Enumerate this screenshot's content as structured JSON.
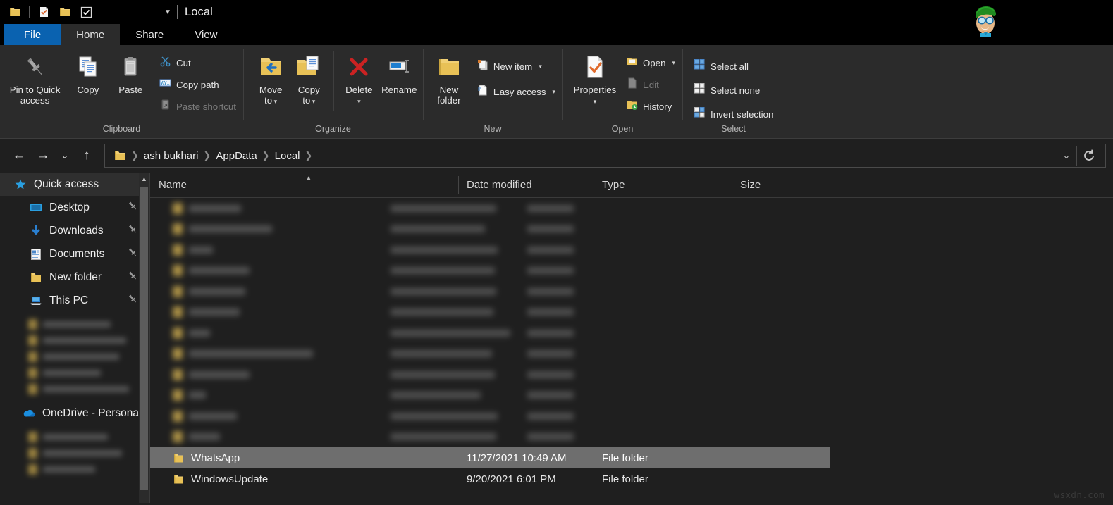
{
  "window": {
    "title": "Local",
    "quick_access_toolbar": [
      {
        "name": "properties-folder-icon",
        "label": "Properties"
      },
      {
        "name": "new-folder-icon",
        "label": "New folder"
      },
      {
        "name": "customize-checkbox-icon",
        "label": "Customize Quick Access Toolbar"
      }
    ],
    "caret_label": "Customize Quick Access Toolbar",
    "avatar_label": "user-avatar"
  },
  "tabs": [
    {
      "id": "file",
      "label": "File",
      "state": "file-menu"
    },
    {
      "id": "home",
      "label": "Home",
      "state": "active"
    },
    {
      "id": "share",
      "label": "Share",
      "state": "normal"
    },
    {
      "id": "view",
      "label": "View",
      "state": "normal"
    }
  ],
  "ribbon": {
    "groups": [
      {
        "title": "Clipboard",
        "big_buttons": [
          {
            "name": "pin-to-quick-access-button",
            "label": "Pin to Quick\naccess",
            "line1": "Pin to Quick",
            "line2": "access",
            "icon": "pin-icon"
          },
          {
            "name": "copy-button",
            "label": "Copy",
            "icon": "copy-documents-icon"
          },
          {
            "name": "paste-button",
            "label": "Paste",
            "icon": "clipboard-icon"
          }
        ],
        "small_buttons": [
          {
            "name": "cut-button",
            "label": "Cut",
            "icon": "scissors-icon",
            "disabled": false
          },
          {
            "name": "copy-path-button",
            "label": "Copy path",
            "icon": "copy-path-icon",
            "disabled": false
          },
          {
            "name": "paste-shortcut-button",
            "label": "Paste shortcut",
            "icon": "paste-shortcut-icon",
            "disabled": true
          }
        ]
      },
      {
        "title": "Organize",
        "big_buttons": [
          {
            "name": "move-to-button",
            "line1": "Move",
            "line2": "to",
            "label": "Move to",
            "icon": "move-to-icon",
            "dropdown": true
          },
          {
            "name": "copy-to-button",
            "line1": "Copy",
            "line2": "to",
            "label": "Copy to",
            "icon": "copy-to-icon",
            "dropdown": true
          },
          {
            "name": "delete-button",
            "label": "Delete",
            "icon": "red-x-icon",
            "dropdown": true
          },
          {
            "name": "rename-button",
            "label": "Rename",
            "icon": "rename-icon",
            "dropdown": false
          }
        ],
        "small_buttons": []
      },
      {
        "title": "New",
        "big_buttons": [
          {
            "name": "new-folder-button",
            "line1": "New",
            "line2": "folder",
            "label": "New folder",
            "icon": "new-folder-icon"
          }
        ],
        "small_buttons": [
          {
            "name": "new-item-button",
            "label": "New item",
            "icon": "new-item-icon",
            "dropdown": true
          },
          {
            "name": "easy-access-button",
            "label": "Easy access",
            "icon": "easy-access-icon",
            "dropdown": true
          }
        ]
      },
      {
        "title": "Open",
        "big_buttons": [
          {
            "name": "properties-button",
            "label": "Properties",
            "icon": "properties-icon",
            "dropdown": true
          }
        ],
        "small_buttons": [
          {
            "name": "open-button",
            "label": "Open",
            "icon": "open-folder-icon",
            "dropdown": true
          },
          {
            "name": "edit-button",
            "label": "Edit",
            "icon": "edit-icon",
            "disabled": true
          },
          {
            "name": "history-button",
            "label": "History",
            "icon": "history-icon",
            "disabled": false
          }
        ]
      },
      {
        "title": "Select",
        "big_buttons": [],
        "small_buttons": [
          {
            "name": "select-all-button",
            "label": "Select all",
            "icon": "select-all-icon"
          },
          {
            "name": "select-none-button",
            "label": "Select none",
            "icon": "select-none-icon"
          },
          {
            "name": "invert-selection-button",
            "label": "Invert selection",
            "icon": "invert-selection-icon"
          }
        ]
      }
    ]
  },
  "addressbar": {
    "back": "back-arrow",
    "forward": "forward-arrow",
    "recent": "recent-locations-chevron",
    "up": "up-arrow",
    "breadcrumbs": [
      "ash bukhari",
      "AppData",
      "Local"
    ],
    "dropdown": "address-dropdown",
    "refresh": "refresh-icon"
  },
  "sidebar": {
    "quick_access": {
      "label": "Quick access",
      "icon": "star-icon"
    },
    "items": [
      {
        "label": "Desktop",
        "icon": "desktop-icon",
        "pinned": true
      },
      {
        "label": "Downloads",
        "icon": "download-arrow-icon",
        "pinned": true
      },
      {
        "label": "Documents",
        "icon": "documents-icon",
        "pinned": true
      },
      {
        "label": "New folder",
        "icon": "folder-icon",
        "pinned": true
      },
      {
        "label": "This PC",
        "icon": "this-pc-icon",
        "pinned": true
      }
    ],
    "onedrive": {
      "label": "OneDrive - Persona",
      "icon": "onedrive-cloud-icon"
    },
    "redacted_group_1_rows": 5,
    "redacted_group_2_rows": 3
  },
  "filelist": {
    "columns": [
      {
        "key": "name",
        "label": "Name",
        "sorted": "asc"
      },
      {
        "key": "date",
        "label": "Date modified"
      },
      {
        "key": "type",
        "label": "Type"
      },
      {
        "key": "size",
        "label": "Size"
      }
    ],
    "redacted_rows": 12,
    "rows": [
      {
        "name": "WhatsApp",
        "date": "11/27/2021 10:49 AM",
        "type": "File folder",
        "size": "",
        "selected": true,
        "icon": "folder-icon"
      },
      {
        "name": "WindowsUpdate",
        "date": "9/20/2021 6:01 PM",
        "type": "File folder",
        "size": "",
        "selected": false,
        "icon": "folder-icon"
      }
    ]
  },
  "watermark": "wsxdn.com",
  "colors": {
    "accent": "#0a62b0",
    "titlebar_bg": "#000000",
    "ribbon_bg": "#2b2b2b",
    "content_bg": "#1f1f1f",
    "selection_bg": "#6e6e6e",
    "folder_yellow": "#e8c156",
    "delete_red": "#cc2222",
    "text": "#e8e8e8"
  }
}
